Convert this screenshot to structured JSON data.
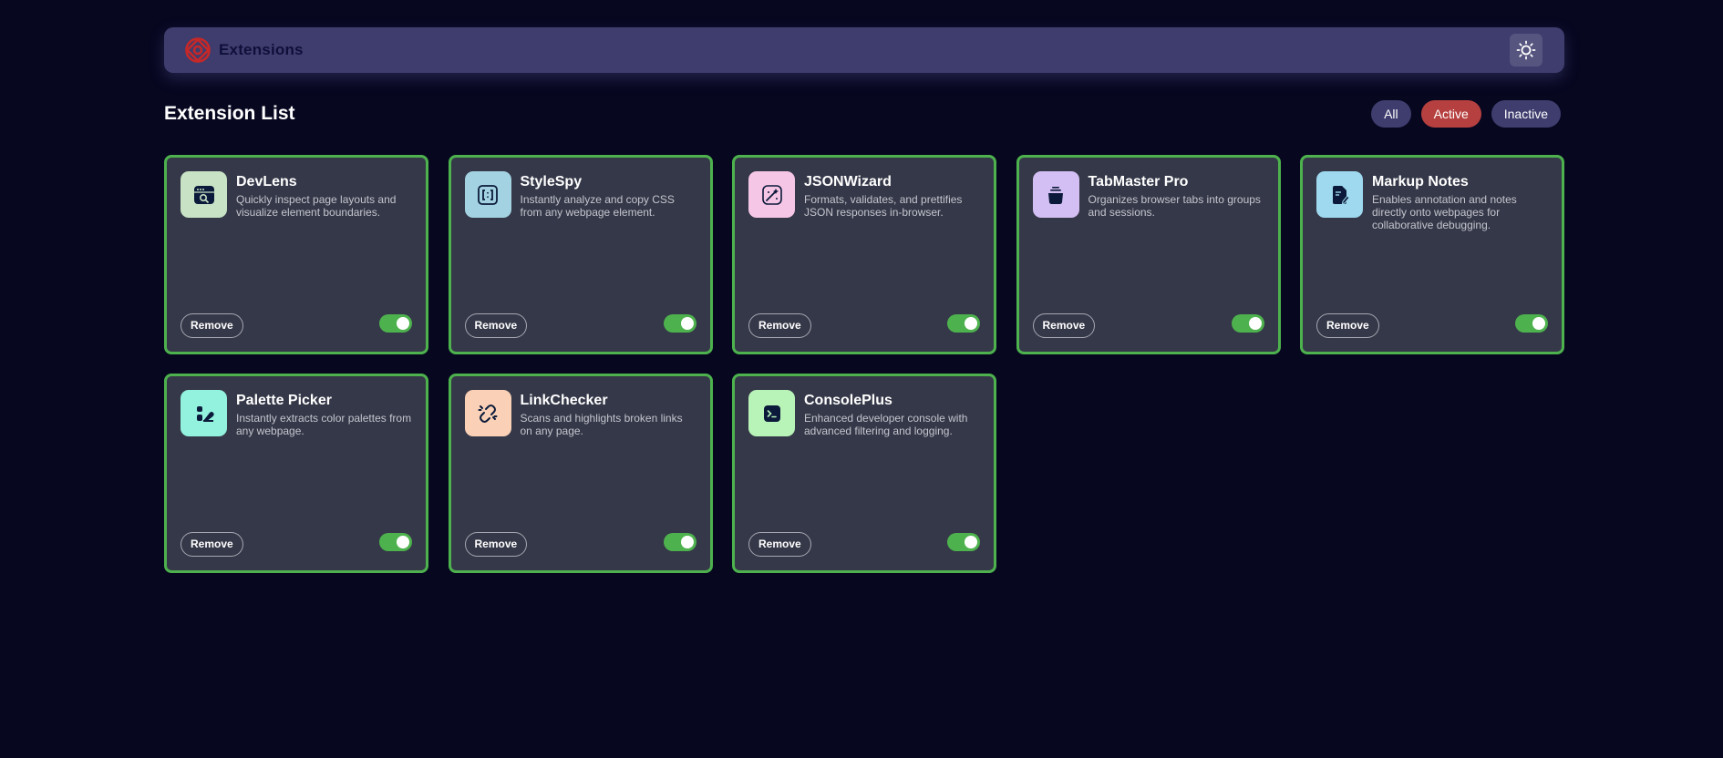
{
  "header": {
    "brand": "Extensions",
    "logo_icon": "extensions-logo-icon",
    "theme_icon": "sun-icon",
    "logo_color": "#c62828",
    "bar_color": "#3e3d6e"
  },
  "list": {
    "title": "Extension List",
    "filters": {
      "all": "All",
      "active": "Active",
      "inactive": "Inactive",
      "selected": "Active"
    }
  },
  "colors": {
    "background": "#070720",
    "card": "#353848",
    "card_border": "#4db24d",
    "active_filter": "#b6403f",
    "toggle_on": "#4db24d"
  },
  "extensions": [
    {
      "name": "DevLens",
      "description": "Quickly inspect page layouts and visualize element boundaries.",
      "icon": "devlens-icon",
      "icon_bg": "#c7e2c4",
      "enabled": true,
      "remove_label": "Remove"
    },
    {
      "name": "StyleSpy",
      "description": "Instantly analyze and copy CSS from any webpage element.",
      "icon": "stylespy-icon",
      "icon_bg": "#a3d3e2",
      "enabled": true,
      "remove_label": "Remove"
    },
    {
      "name": "JSONWizard",
      "description": "Formats, validates, and prettifies JSON responses in-browser.",
      "icon": "jsonwizard-icon",
      "icon_bg": "#f6c6e6",
      "enabled": true,
      "remove_label": "Remove"
    },
    {
      "name": "TabMaster Pro",
      "description": "Organizes browser tabs into groups and sessions.",
      "icon": "tabmaster-icon",
      "icon_bg": "#d3bff3",
      "enabled": true,
      "remove_label": "Remove"
    },
    {
      "name": "Markup Notes",
      "description": "Enables annotation and notes directly onto webpages for collaborative debugging.",
      "icon": "markup-notes-icon",
      "icon_bg": "#9ed9ef",
      "enabled": true,
      "remove_label": "Remove"
    },
    {
      "name": "Palette Picker",
      "description": "Instantly extracts color palettes from any webpage.",
      "icon": "palette-picker-icon",
      "icon_bg": "#92f2dd",
      "enabled": true,
      "remove_label": "Remove"
    },
    {
      "name": "LinkChecker",
      "description": "Scans and highlights broken links on any page.",
      "icon": "linkchecker-icon",
      "icon_bg": "#fad1b6",
      "enabled": true,
      "remove_label": "Remove"
    },
    {
      "name": "ConsolePlus",
      "description": "Enhanced developer console with advanced filtering and logging.",
      "icon": "consoleplus-icon",
      "icon_bg": "#b8f3b8",
      "enabled": true,
      "remove_label": "Remove"
    }
  ]
}
